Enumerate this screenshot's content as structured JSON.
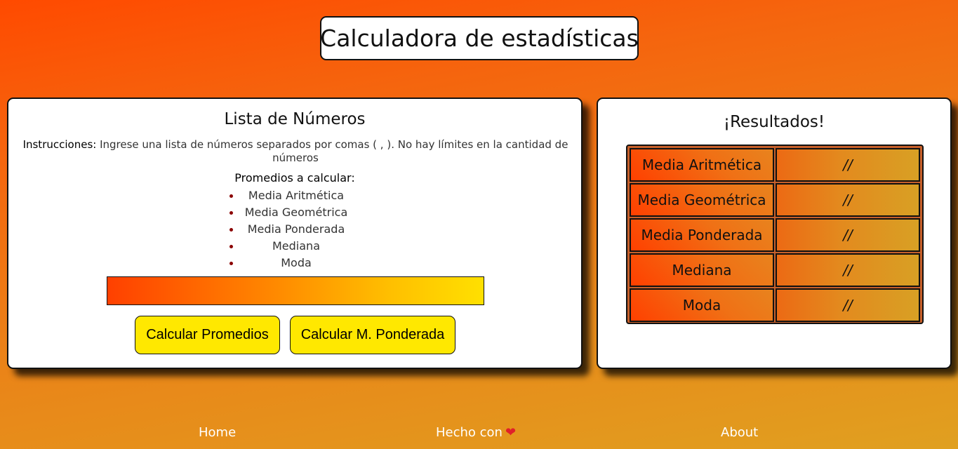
{
  "app": {
    "title": "Calculadora de estadísticas"
  },
  "input_panel": {
    "title": "Lista de Números",
    "instructions_label": "Instrucciones:",
    "instructions_text": " Ingrese una lista de números separados por comas ( , ). No hay límites en la cantidad de números",
    "averages_title": "Promedios a calcular:",
    "averages": [
      "Media Aritmética",
      "Media Geométrica",
      "Media Ponderada",
      "Mediana",
      "Moda"
    ],
    "input_value": "",
    "input_placeholder": "",
    "buttons": {
      "calculate_averages": "Calcular Promedios",
      "calculate_weighted": "Calcular M. Ponderada"
    }
  },
  "results_panel": {
    "title": "¡Resultados!",
    "rows": [
      {
        "label": "Media Aritmética",
        "value": "//"
      },
      {
        "label": "Media Geométrica",
        "value": "//"
      },
      {
        "label": "Media Ponderada",
        "value": "//"
      },
      {
        "label": "Mediana",
        "value": "//"
      },
      {
        "label": "Moda",
        "value": "//"
      }
    ]
  },
  "footer": {
    "home": "Home",
    "made_with": "Hecho con",
    "heart_icon": "heart-icon",
    "about": "About"
  },
  "colors": {
    "accent_yellow": "#ffe800",
    "bullet": "#8b0000",
    "heart": "#e0202a"
  }
}
